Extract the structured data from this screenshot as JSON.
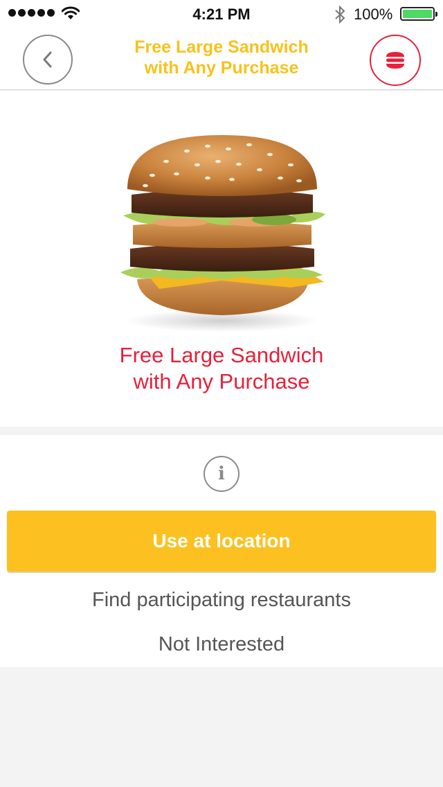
{
  "status_bar": {
    "time": "4:21 PM",
    "battery_percent": "100%",
    "signal_bars": 5,
    "icons": [
      "signal-dots-icon",
      "wifi-icon",
      "bluetooth-icon",
      "battery-icon"
    ]
  },
  "nav": {
    "title": "Free Large Sandwich\nwith Any Purchase",
    "back_icon": "chevron-left-icon",
    "menu_icon": "burger-menu-icon"
  },
  "offer": {
    "image": "big-mac-burger-image",
    "title": "Free Large Sandwich\nwith Any Purchase"
  },
  "actions": {
    "info_icon_glyph": "i",
    "use_label": "Use at location",
    "find_label": "Find participating restaurants",
    "not_interested_label": "Not Interested"
  },
  "colors": {
    "brand_red": "#e8203a",
    "brand_yellow": "#fcc121",
    "title_yellow": "#f7c21c",
    "battery_green": "#4cd964"
  }
}
